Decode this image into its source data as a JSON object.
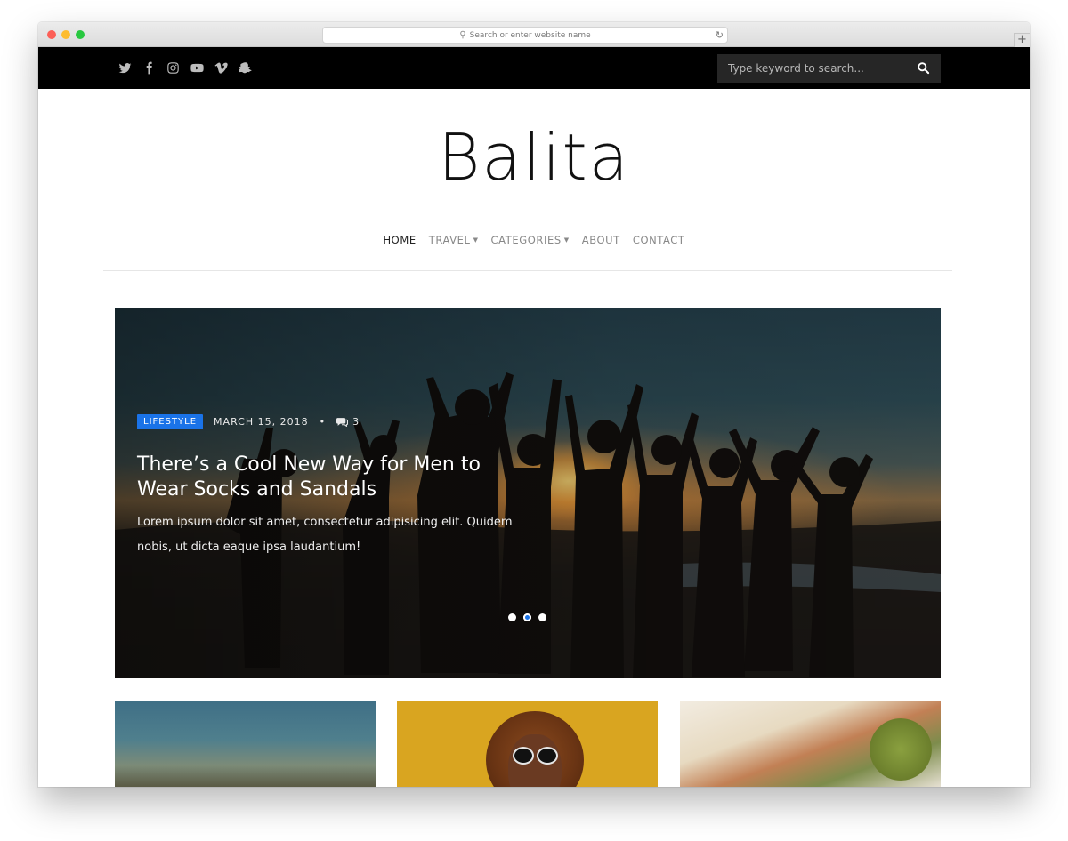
{
  "browser": {
    "address_placeholder": "Search or enter website name",
    "new_tab_label": "+"
  },
  "topbar": {
    "social_icons": [
      "twitter-icon",
      "facebook-icon",
      "instagram-icon",
      "youtube-icon",
      "vimeo-icon",
      "snapchat-icon"
    ],
    "search_placeholder": "Type keyword to search..."
  },
  "site": {
    "logo": "Balita"
  },
  "nav": {
    "items": [
      {
        "label": "HOME",
        "active": true,
        "dropdown": false
      },
      {
        "label": "TRAVEL",
        "active": false,
        "dropdown": true
      },
      {
        "label": "CATEGORIES",
        "active": false,
        "dropdown": true
      },
      {
        "label": "ABOUT",
        "active": false,
        "dropdown": false
      },
      {
        "label": "CONTACT",
        "active": false,
        "dropdown": false
      }
    ]
  },
  "hero": {
    "category": "LIFESTYLE",
    "date": "MARCH 15, 2018",
    "separator": "•",
    "comments": "3",
    "title": "There’s a Cool New Way for Men to Wear Socks and Sandals",
    "excerpt": "Lorem ipsum dolor sit amet, consectetur adipisicing elit. Quidem nobis, ut dicta eaque ipsa laudantium!",
    "slides": 3,
    "active_slide": 2
  },
  "colors": {
    "accent": "#1a73e8",
    "topbar_bg": "#000000",
    "search_bg": "#262626"
  }
}
